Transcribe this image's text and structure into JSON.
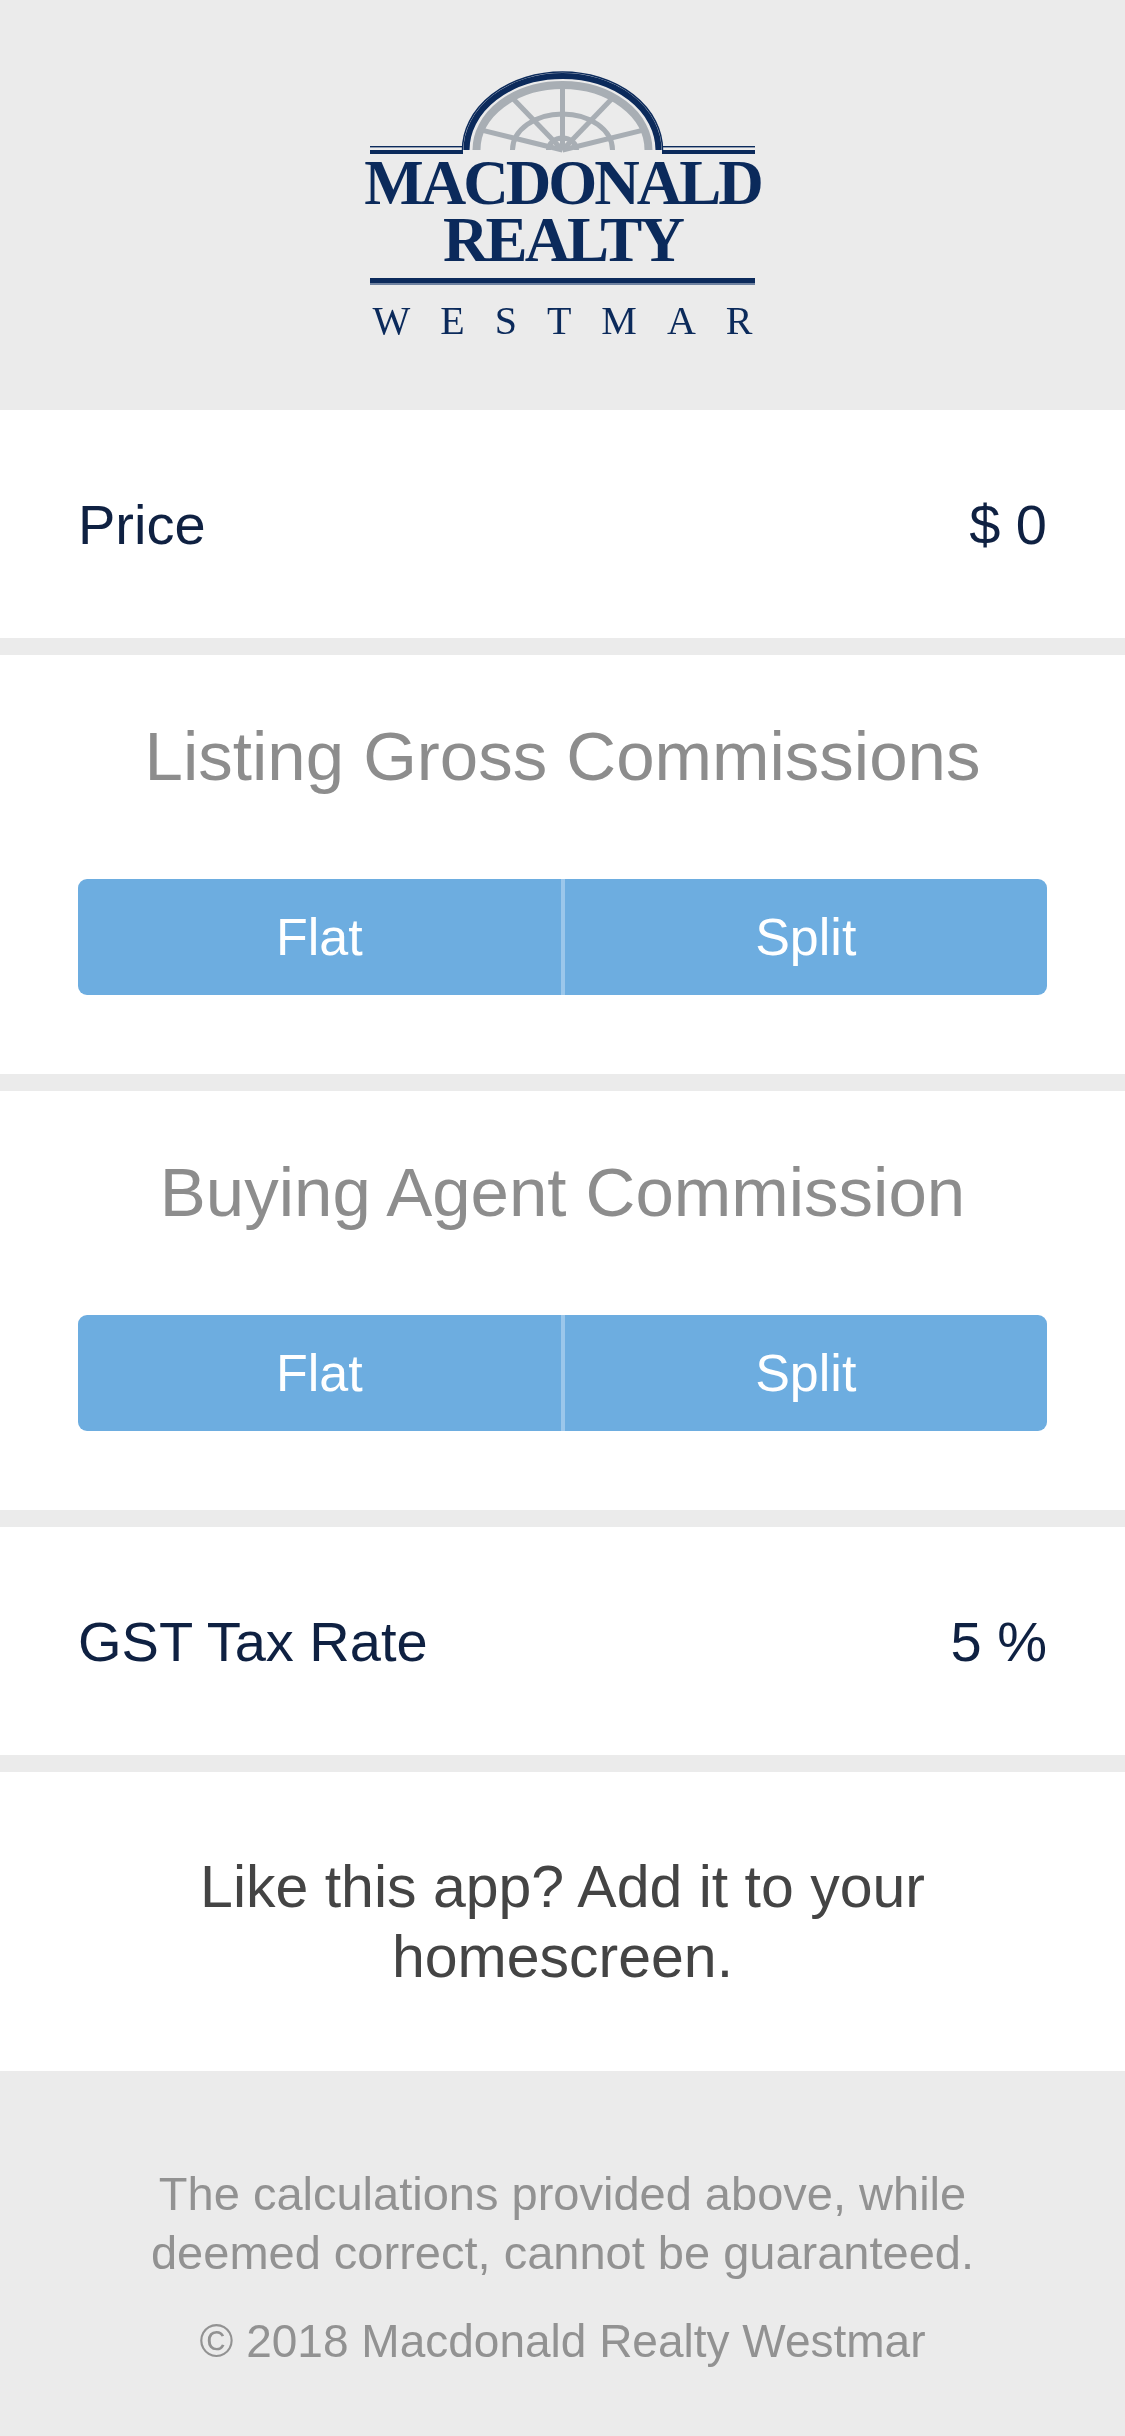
{
  "logo": {
    "lines": [
      "MACDONALD",
      "REALTY"
    ],
    "tagline": "WESTMAR"
  },
  "price_field": {
    "label": "Price",
    "value": "$ 0"
  },
  "commission_sections": [
    {
      "title": "Listing Gross Commissions",
      "options": [
        {
          "label": "Flat",
          "selected": false
        },
        {
          "label": "Split",
          "selected": false
        }
      ]
    },
    {
      "title": "Buying Agent Commission",
      "options": [
        {
          "label": "Flat",
          "selected": false
        },
        {
          "label": "Split",
          "selected": false
        }
      ]
    }
  ],
  "tax_field": {
    "label": "GST Tax Rate",
    "value": "5 %"
  },
  "promo_text": "Like this app? Add it to your homescreen.",
  "footer": {
    "disclaimer": "The calculations provided above, while deemed correct, cannot be guaranteed.",
    "copyright": "© 2018 Macdonald Realty Westmar"
  }
}
